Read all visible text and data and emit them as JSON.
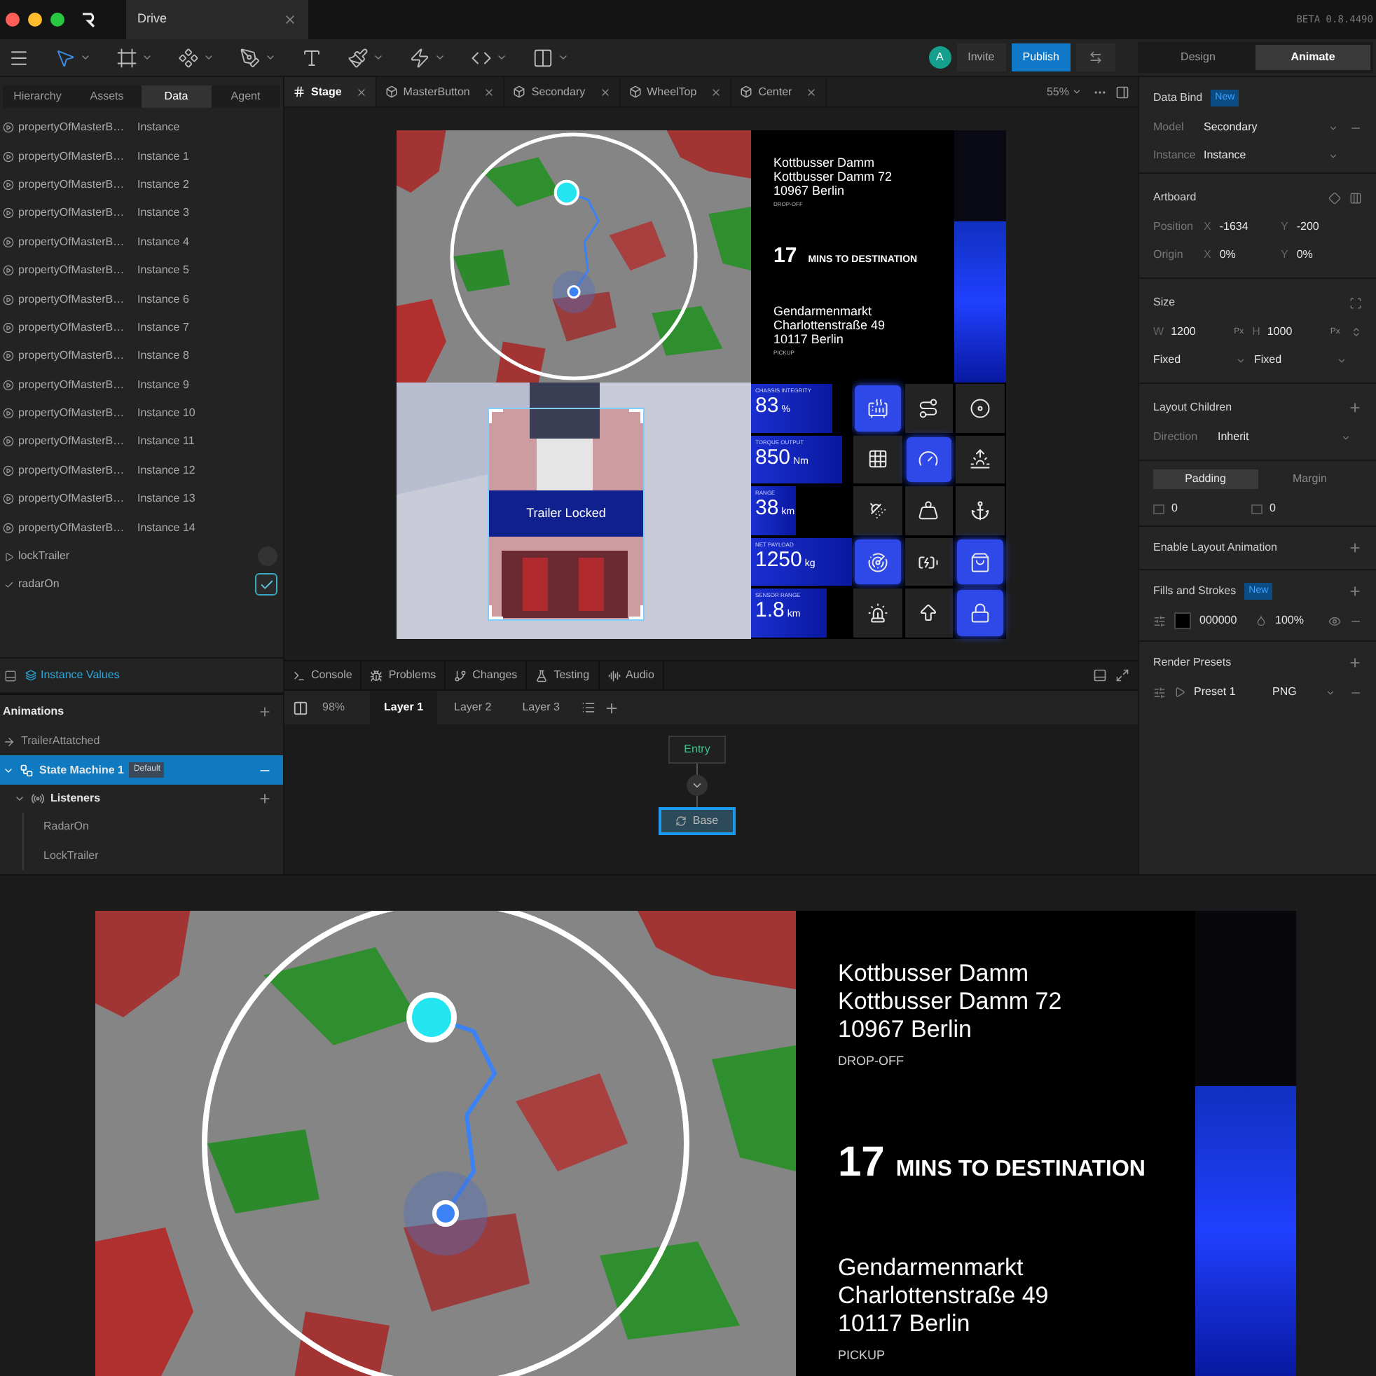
{
  "window": {
    "tab": "Drive",
    "version": "BETA 0.8.4490"
  },
  "toolbar": {
    "avatar": "A",
    "invite": "Invite",
    "publish": "Publish",
    "modes": [
      {
        "label": "Design",
        "selected": false
      },
      {
        "label": "Animate",
        "selected": true
      }
    ]
  },
  "left_panel": {
    "tabs": [
      {
        "label": "Hierarchy",
        "selected": false
      },
      {
        "label": "Assets",
        "selected": false
      },
      {
        "label": "Data",
        "selected": true
      },
      {
        "label": "Agent",
        "selected": false
      }
    ],
    "properties": [
      {
        "name": "propertyOfMasterB…",
        "value": "Instance"
      },
      {
        "name": "propertyOfMasterB…",
        "value": "Instance 1"
      },
      {
        "name": "propertyOfMasterB…",
        "value": "Instance 2"
      },
      {
        "name": "propertyOfMasterB…",
        "value": "Instance 3"
      },
      {
        "name": "propertyOfMasterB…",
        "value": "Instance 4"
      },
      {
        "name": "propertyOfMasterB…",
        "value": "Instance 5"
      },
      {
        "name": "propertyOfMasterB…",
        "value": "Instance 6"
      },
      {
        "name": "propertyOfMasterB…",
        "value": "Instance 7"
      },
      {
        "name": "propertyOfMasterB…",
        "value": "Instance 8"
      },
      {
        "name": "propertyOfMasterB…",
        "value": "Instance 9"
      },
      {
        "name": "propertyOfMasterB…",
        "value": "Instance 10"
      },
      {
        "name": "propertyOfMasterB…",
        "value": "Instance 11"
      },
      {
        "name": "propertyOfMasterB…",
        "value": "Instance 12"
      },
      {
        "name": "propertyOfMasterB…",
        "value": "Instance 13"
      },
      {
        "name": "propertyOfMasterB…",
        "value": "Instance 14"
      }
    ],
    "inputs": [
      {
        "name": "lockTrailer",
        "kind": "trigger"
      },
      {
        "name": "radarOn",
        "kind": "boolean",
        "checked": true
      }
    ],
    "footer": "Instance Values"
  },
  "animations": {
    "title": "Animations",
    "items": [
      {
        "name": "TrailerAttatched",
        "kind": "animation",
        "selected": false
      },
      {
        "name": "State Machine 1",
        "kind": "state_machine",
        "badge": "Default",
        "selected": true,
        "children": [
          {
            "name": "Listeners",
            "kind": "group",
            "children": [
              {
                "name": "RadarOn",
                "kind": "listener"
              },
              {
                "name": "LockTrailer",
                "kind": "listener"
              }
            ]
          }
        ]
      }
    ]
  },
  "stage": {
    "tabs": [
      {
        "label": "Stage",
        "kind": "stage",
        "selected": true
      },
      {
        "label": "MasterButton",
        "kind": "component",
        "selected": false
      },
      {
        "label": "Secondary",
        "kind": "component",
        "selected": false
      },
      {
        "label": "WheelTop",
        "kind": "component",
        "selected": false
      },
      {
        "label": "Center",
        "kind": "component",
        "selected": false
      }
    ],
    "zoom": "55%",
    "dashboard": {
      "dropoff": {
        "lines": [
          "Kottbusser Damm",
          "Kottbusser Damm 72",
          "10967 Berlin"
        ],
        "label": "DROP-OFF"
      },
      "eta": {
        "value": "17",
        "label": "MINS TO DESTINATION"
      },
      "pickup": {
        "lines": [
          "Gendarmenmarkt",
          "Charlottenstraße 49",
          "10117 Berlin"
        ],
        "label": "PICKUP"
      },
      "trailer_label": "Trailer Locked",
      "metrics": [
        {
          "label": "CHASSIS INTEGRITY",
          "value": "83",
          "unit": "%",
          "level": 0.8
        },
        {
          "label": "TORQUE OUTPUT",
          "value": "850",
          "unit": "Nm",
          "level": 0.9
        },
        {
          "label": "RANGE",
          "value": "38",
          "unit": "km",
          "level": 0.45
        },
        {
          "label": "NET PAYLOAD",
          "value": "1250",
          "unit": "kg",
          "level": 1
        },
        {
          "label": "SENSOR RANGE",
          "value": "1.8",
          "unit": "km",
          "level": 0.75
        }
      ],
      "controls": [
        {
          "active": true
        },
        {
          "active": false
        },
        {
          "active": false
        },
        {
          "active": false
        },
        {
          "active": true
        },
        {
          "active": false
        },
        {
          "active": false
        },
        {
          "active": false
        },
        {
          "active": false
        },
        {
          "active": true
        },
        {
          "active": false
        },
        {
          "active": true
        },
        {
          "active": false
        },
        {
          "active": false
        },
        {
          "active": true
        }
      ]
    }
  },
  "bottom_panel": {
    "tabs": [
      "Console",
      "Problems",
      "Changes",
      "Testing",
      "Audio"
    ],
    "zoom": "98%",
    "layers": [
      {
        "label": "Layer 1",
        "selected": true
      },
      {
        "label": "Layer 2",
        "selected": false
      },
      {
        "label": "Layer 3",
        "selected": false
      }
    ],
    "nodes": [
      {
        "label": "Entry",
        "kind": "entry",
        "selected": false
      },
      {
        "label": "Base",
        "kind": "state",
        "selected": true
      }
    ]
  },
  "inspector": {
    "data_bind": {
      "title": "Data Bind",
      "badge": "New",
      "fields": [
        {
          "label": "Model",
          "value": "Secondary"
        },
        {
          "label": "Instance",
          "value": "Instance"
        }
      ]
    },
    "artboard": {
      "title": "Artboard",
      "rows": [
        {
          "label": "Position",
          "fields": [
            {
              "axis": "X",
              "value": "-1634"
            },
            {
              "axis": "Y",
              "value": "-200"
            }
          ]
        },
        {
          "label": "Origin",
          "fields": [
            {
              "axis": "X",
              "value": "0%"
            },
            {
              "axis": "Y",
              "value": "0%"
            }
          ]
        }
      ]
    },
    "size": {
      "title": "Size",
      "fields": [
        {
          "axis": "W",
          "value": "1200",
          "unit": "Px"
        },
        {
          "axis": "H",
          "value": "1000",
          "unit": "Px"
        }
      ],
      "modes": [
        "Fixed",
        "Fixed"
      ]
    },
    "layout_children": {
      "title": "Layout Children",
      "label": "Direction",
      "value": "Inherit"
    },
    "spacing": {
      "tabs": [
        {
          "label": "Padding",
          "selected": true
        },
        {
          "label": "Margin",
          "selected": false
        }
      ],
      "values": [
        "0",
        "0"
      ]
    },
    "layout_animation": "Enable Layout Animation",
    "fills": {
      "title": "Fills and Strokes",
      "badge": "New",
      "hex": "000000",
      "opacity": "100%"
    },
    "render": {
      "title": "Render Presets",
      "preset": "Preset 1",
      "format": "PNG"
    }
  },
  "preview": {
    "dropoff": {
      "lines": [
        "Kottbusser Damm",
        "Kottbusser Damm 72",
        "10967 Berlin"
      ],
      "label": "DROP-OFF"
    },
    "eta": {
      "value": "17",
      "label": "MINS TO DESTINATION"
    },
    "pickup": {
      "lines": [
        "Gendarmenmarkt",
        "Charlottenstraße 49",
        "10117 Berlin"
      ],
      "label": "PICKUP"
    }
  }
}
